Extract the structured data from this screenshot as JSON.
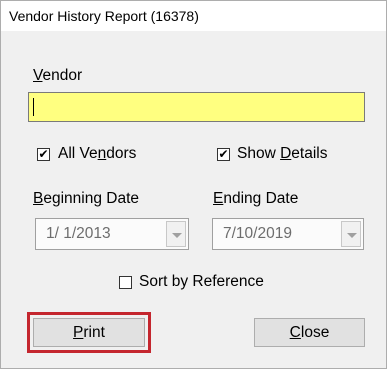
{
  "window": {
    "title": "Vendor History Report (16378)"
  },
  "vendor": {
    "label": "Vendor",
    "value": ""
  },
  "all_vendors": {
    "label": "All Vendors",
    "checked": true
  },
  "show_details": {
    "label": "Show Details",
    "checked": true
  },
  "beginning_date": {
    "label": "Beginning Date",
    "value": "1/ 1/2013"
  },
  "ending_date": {
    "label": "Ending Date",
    "value": "7/10/2019"
  },
  "sort_by_reference": {
    "label": "Sort by Reference",
    "checked": false
  },
  "buttons": {
    "print": "Print",
    "close": "Close"
  },
  "colors": {
    "vendor_field_bg": "#ffff80",
    "highlight": "#c4262e"
  }
}
